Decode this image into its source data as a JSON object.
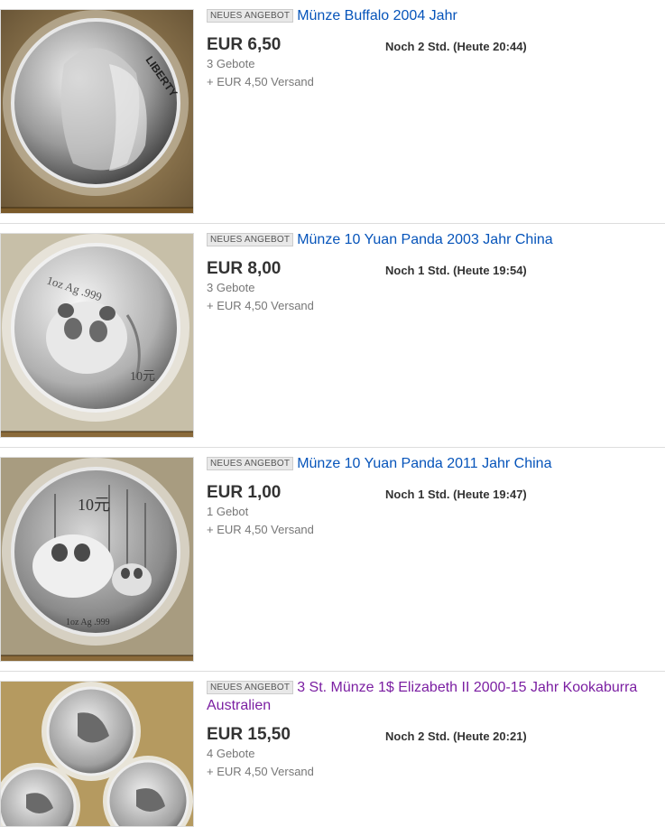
{
  "listings": [
    {
      "badge": "NEUES ANGEBOT",
      "title": "Münze Buffalo 2004 Jahr",
      "price": "EUR 6,50",
      "time_left": "Noch 2 Std. (Heute 20:44)",
      "bids": "3 Gebote",
      "shipping": "+ EUR 4,50 Versand",
      "coin_text": "LIBERTY"
    },
    {
      "badge": "NEUES ANGEBOT",
      "title": "Münze 10 Yuan Panda 2003 Jahr China",
      "price": "EUR 8,00",
      "time_left": "Noch 1 Std. (Heute 19:54)",
      "bids": "3 Gebote",
      "shipping": "+ EUR 4,50 Versand",
      "coin_text": "1oz Ag .999",
      "coin_value": "10元"
    },
    {
      "badge": "NEUES ANGEBOT",
      "title": "Münze 10 Yuan Panda 2011 Jahr China",
      "price": "EUR 1,00",
      "time_left": "Noch 1 Std. (Heute 19:47)",
      "bids": "1 Gebot",
      "shipping": "+ EUR 4,50 Versand",
      "coin_text": "1oz Ag .999",
      "coin_value": "10元"
    },
    {
      "badge": "NEUES ANGEBOT",
      "title": "3 St. Münze 1$ Elizabeth II 2000-15 Jahr Kookaburra Australien",
      "price": "EUR 15,50",
      "time_left": "Noch 2 Std. (Heute 20:21)",
      "bids": "4 Gebote",
      "shipping": "+ EUR 4,50 Versand"
    }
  ],
  "colors": {
    "link": "#0654ba",
    "visited_link": "#7b1fa2",
    "price": "#333333",
    "muted": "#777777",
    "separator": "#dddddd"
  }
}
